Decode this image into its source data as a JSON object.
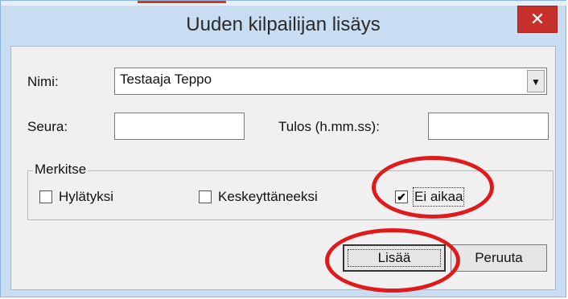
{
  "window": {
    "title": "Uuden kilpailijan lisäys",
    "close_glyph": "✕"
  },
  "form": {
    "name_label": "Nimi:",
    "name_value": "Testaaja Teppo",
    "club_label": "Seura:",
    "club_value": "",
    "result_label": "Tulos (h.mm.ss):",
    "result_value": ""
  },
  "mark_group": {
    "legend": "Merkitse",
    "options": [
      {
        "label": "Hylätyksi",
        "checked": false
      },
      {
        "label": "Keskeyttäneeksi",
        "checked": false
      },
      {
        "label": "Ei aikaa",
        "checked": true
      }
    ]
  },
  "buttons": {
    "add_label": "Lisää",
    "cancel_label": "Peruuta"
  },
  "colors": {
    "annotation": "#e0191b",
    "close_button": "#c7302b",
    "titlebar": "#c9ddf2"
  },
  "icons": {
    "dropdown": "▼",
    "checkmark": "✔"
  }
}
